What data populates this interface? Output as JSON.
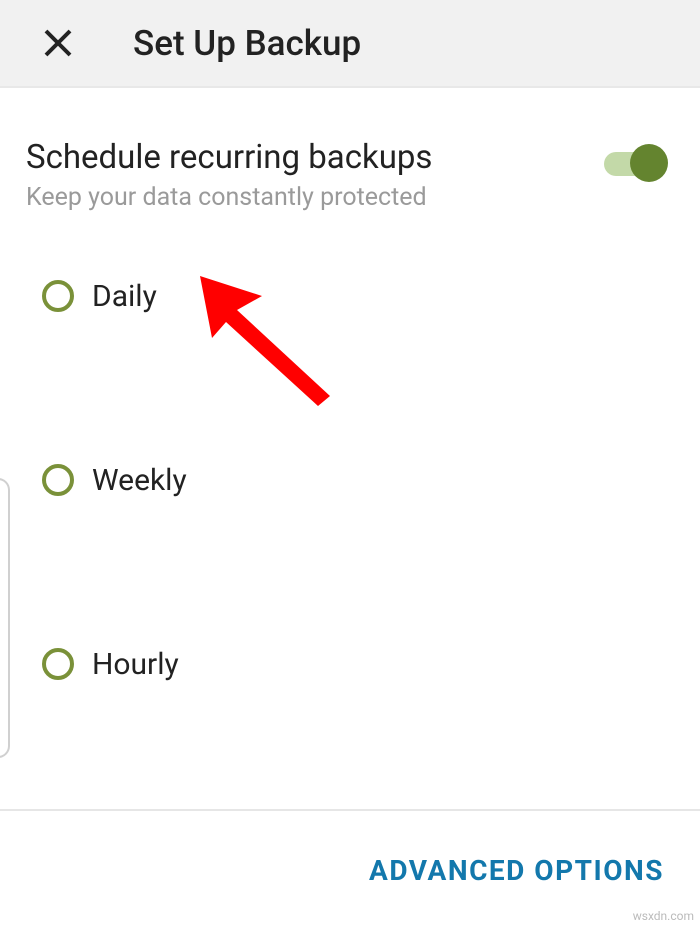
{
  "header": {
    "title": "Set Up Backup"
  },
  "schedule": {
    "title": "Schedule recurring backups",
    "subtitle": "Keep your data constantly protected",
    "toggle_on": true
  },
  "options": [
    {
      "key": "daily",
      "label": "Daily"
    },
    {
      "key": "weekly",
      "label": "Weekly"
    },
    {
      "key": "hourly",
      "label": "Hourly"
    }
  ],
  "footer": {
    "advanced": "ADVANCED OPTIONS"
  },
  "watermark": "wsxdn.com"
}
